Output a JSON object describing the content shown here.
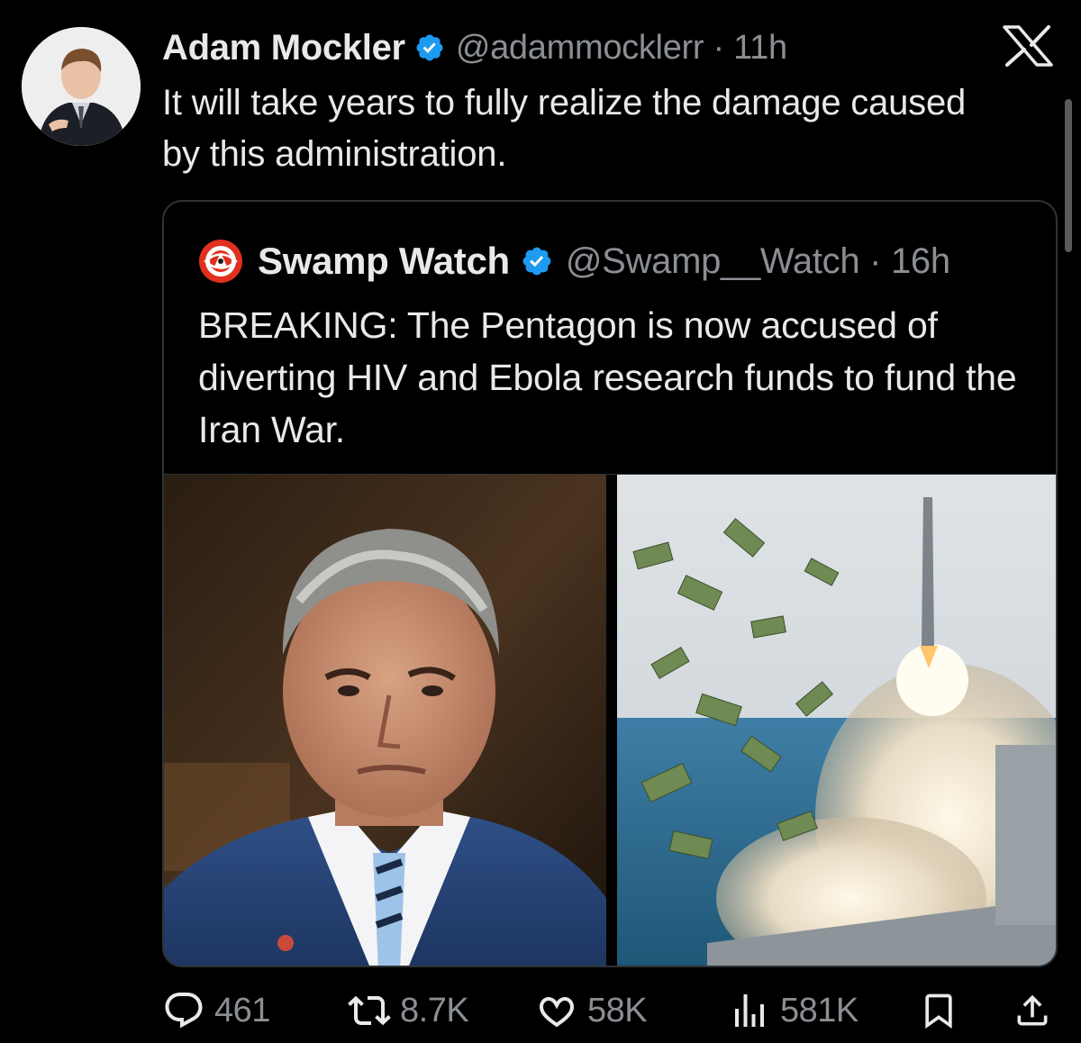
{
  "tweet": {
    "author_name": "Adam Mockler",
    "author_handle": "@adammocklerr · 11h",
    "text": "It will take years to fully realize the damage caused by this administration.",
    "verified_icon": "verified-badge-icon",
    "avatar_icon": "user-avatar"
  },
  "quoted": {
    "author_name": "Swamp Watch",
    "author_handle": "@Swamp__Watch · 16h",
    "text": "BREAKING: The Pentagon is now accused of diverting HIV and Ebola research funds to fund the Iran War.",
    "logo_icon": "swamp-watch-logo",
    "media": [
      {
        "icon": "photo-man-in-suit"
      },
      {
        "icon": "photo-missile-launch-money"
      }
    ]
  },
  "actions": {
    "replies": "461",
    "reposts": "8.7K",
    "likes": "58K",
    "views": "581K"
  },
  "colors": {
    "background": "#000000",
    "text": "#e7e9ea",
    "muted": "#8b8f94",
    "verified": "#1d9bf0",
    "border": "#2f3336"
  }
}
